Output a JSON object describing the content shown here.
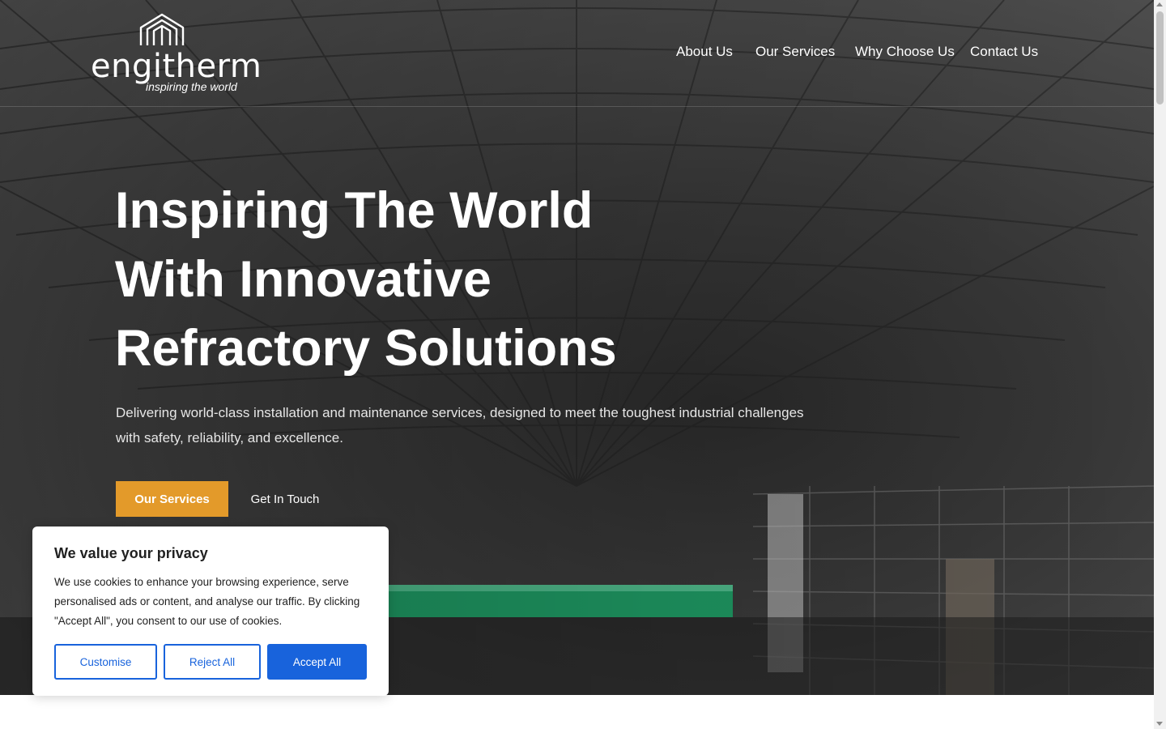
{
  "brand": {
    "name": "engitherm",
    "tagline": "inspiring the world"
  },
  "nav": {
    "items": [
      {
        "label": "About Us"
      },
      {
        "label": "Our Services"
      },
      {
        "label": "Why Choose Us"
      },
      {
        "label": "Contact Us"
      }
    ]
  },
  "hero": {
    "headline_lines": [
      "Inspiring The World",
      "With Innovative",
      "Refractory Solutions"
    ],
    "subtitle": "Delivering world-class installation and maintenance services, designed to meet the toughest industrial challenges with safety, reliability, and excellence.",
    "primary_cta": "Our Services",
    "secondary_cta": "Get In Touch"
  },
  "cookie_banner": {
    "title": "We value your privacy",
    "text": "We use cookies to enhance your browsing experience, serve personalised ads or content, and analyse our traffic. By clicking \"Accept All\", you consent to our use of cookies.",
    "customise_label": "Customise",
    "reject_label": "Reject All",
    "accept_label": "Accept All"
  },
  "colors": {
    "accent": "#e39a2a",
    "cookie_primary": "#1863dc",
    "text_dark": "#212121"
  },
  "icons": {
    "logo_mark": "building-outline-icon"
  }
}
